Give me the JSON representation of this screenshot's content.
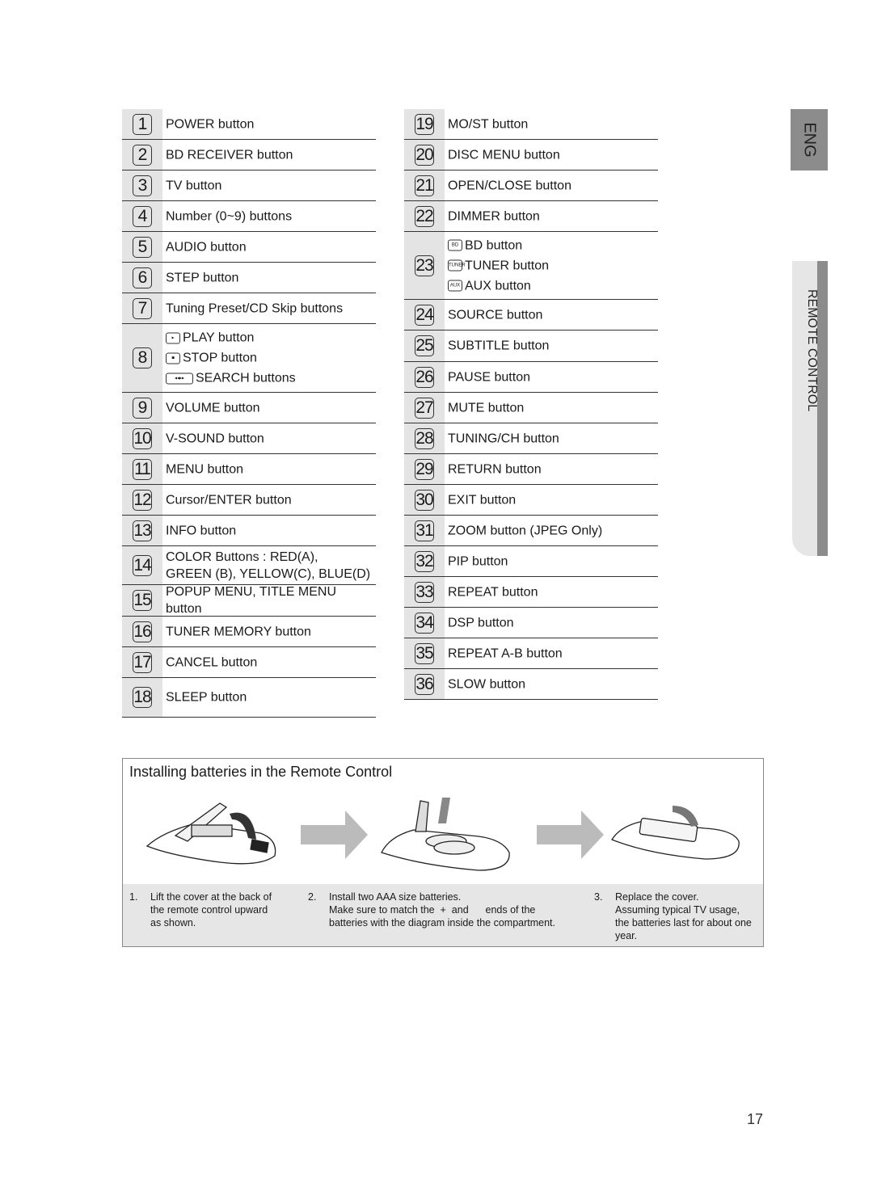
{
  "left_items": [
    {
      "n": "1",
      "lines": [
        "POWER button"
      ]
    },
    {
      "n": "2",
      "lines": [
        "BD RECEIVER button"
      ]
    },
    {
      "n": "3",
      "lines": [
        "TV button"
      ]
    },
    {
      "n": "4",
      "lines": [
        "Number (0~9) buttons"
      ]
    },
    {
      "n": "5",
      "lines": [
        "AUDIO button"
      ]
    },
    {
      "n": "6",
      "lines": [
        "STEP button"
      ]
    },
    {
      "n": "7",
      "lines": [
        "Tuning Preset/CD Skip buttons"
      ]
    },
    {
      "n": "8",
      "lines": [
        "PLAY button",
        "STOP button",
        "SEARCH buttons"
      ],
      "icons": [
        "play-icon",
        "stop-icon",
        "search-icon"
      ]
    },
    {
      "n": "9",
      "lines": [
        "VOLUME button"
      ]
    },
    {
      "n": "10",
      "lines": [
        "V-SOUND button"
      ]
    },
    {
      "n": "11",
      "lines": [
        "MENU button"
      ]
    },
    {
      "n": "12",
      "lines": [
        "Cursor/ENTER button"
      ]
    },
    {
      "n": "13",
      "lines": [
        "INFO button"
      ]
    },
    {
      "n": "14",
      "lines": [
        "COLOR Buttons : RED(A),",
        "GREEN (B), YELLOW(C), BLUE(D)"
      ]
    },
    {
      "n": "15",
      "lines": [
        "POPUP MENU, TITLE MENU button"
      ]
    },
    {
      "n": "16",
      "lines": [
        "TUNER MEMORY button"
      ]
    },
    {
      "n": "17",
      "lines": [
        "CANCEL button"
      ]
    },
    {
      "n": "18",
      "lines": [
        "SLEEP button"
      ]
    }
  ],
  "right_items": [
    {
      "n": "19",
      "lines": [
        "MO/ST button"
      ]
    },
    {
      "n": "20",
      "lines": [
        "DISC MENU button"
      ]
    },
    {
      "n": "21",
      "lines": [
        "OPEN/CLOSE button"
      ]
    },
    {
      "n": "22",
      "lines": [
        "DIMMER button"
      ]
    },
    {
      "n": "23",
      "lines": [
        "BD button",
        "TUNER button",
        "AUX button"
      ],
      "icons": [
        "bd-icon",
        "tuner-icon",
        "aux-icon"
      ]
    },
    {
      "n": "24",
      "lines": [
        "SOURCE button"
      ]
    },
    {
      "n": "25",
      "lines": [
        "SUBTITLE button"
      ]
    },
    {
      "n": "26",
      "lines": [
        "PAUSE button"
      ]
    },
    {
      "n": "27",
      "lines": [
        "MUTE button"
      ]
    },
    {
      "n": "28",
      "lines": [
        "TUNING/CH button"
      ]
    },
    {
      "n": "29",
      "lines": [
        "RETURN button"
      ]
    },
    {
      "n": "30",
      "lines": [
        "EXIT button"
      ]
    },
    {
      "n": "31",
      "lines": [
        "ZOOM button (JPEG Only)"
      ]
    },
    {
      "n": "32",
      "lines": [
        "PIP button"
      ]
    },
    {
      "n": "33",
      "lines": [
        "REPEAT button"
      ]
    },
    {
      "n": "34",
      "lines": [
        "DSP button"
      ]
    },
    {
      "n": "35",
      "lines": [
        "REPEAT A-B button"
      ]
    },
    {
      "n": "36",
      "lines": [
        "SLOW button"
      ]
    }
  ],
  "icon_text": {
    "play": "PLAY",
    "stop": "STOP",
    "bd": "BD",
    "tuner": "TUNER",
    "aux": "AUX"
  },
  "tabs": {
    "eng": "ENG",
    "section": "REMOTE CONTROL"
  },
  "batteries": {
    "title": "Installing batteries in the Remote Control",
    "steps": [
      {
        "n": "1.",
        "text": "Lift the cover at the back of\nthe remote control upward\nas shown."
      },
      {
        "n": "2.",
        "text": "Install two AAA size batteries.\nMake sure to match the  +  and      ends of the\nbatteries with the diagram inside the compartment."
      },
      {
        "n": "3.",
        "text": "Replace the cover.\nAssuming typical TV usage,\nthe batteries last for about one\nyear."
      }
    ]
  },
  "page_number": "17"
}
